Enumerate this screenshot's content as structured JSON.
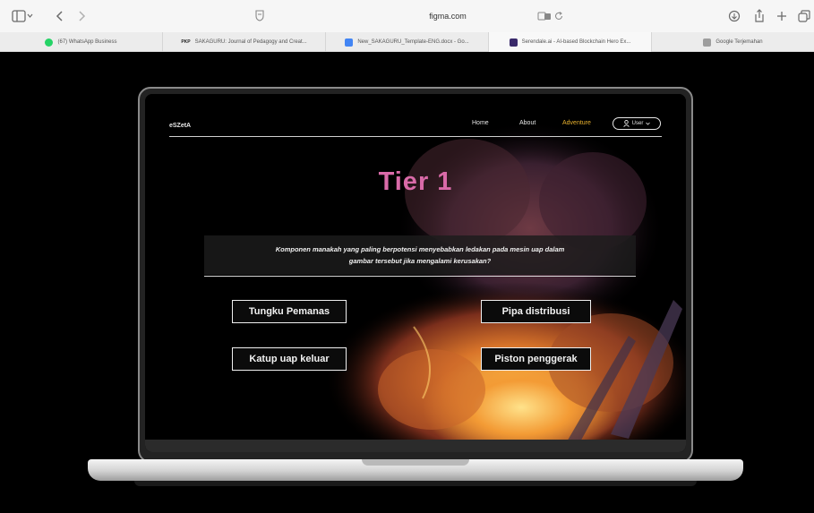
{
  "browser": {
    "address": "figma.com",
    "tabs": [
      {
        "label": "(67) WhatsApp Business",
        "favicon_color": "#25d366"
      },
      {
        "label": "SAKAGURU: Journal of Pedagogy and Creat...",
        "favicon_color": "#222222",
        "favicon_text": "PKP"
      },
      {
        "label": "New_SAKAGURU_Template-ENG.docx - Go...",
        "favicon_color": "#4285f4"
      },
      {
        "label": "Serendale.ai - AI-based Blockchain Hero Ex...",
        "favicon_color": "#3a2a6b"
      },
      {
        "label": "Google Terjemahan",
        "favicon_color": "#9e9e9e"
      }
    ],
    "active_tab_index": 3
  },
  "site": {
    "logo": "eSZetA",
    "nav": {
      "home": "Home",
      "about": "About",
      "adventure": "Adventure",
      "user": "User"
    },
    "tier_title": "Tier 1",
    "question_line1": "Komponen manakah yang paling berpotensi menyebabkan ledakan pada mesin uap dalam",
    "question_line2": "gambar tersebut jika mengalami kerusakan?",
    "answers": [
      "Tungku Pemanas",
      "Pipa distribusi",
      "Katup uap keluar",
      "Piston penggerak"
    ]
  },
  "colors": {
    "tier_title": "#d96aa8",
    "nav_active": "#e8b12e",
    "page_background": "#000000"
  }
}
